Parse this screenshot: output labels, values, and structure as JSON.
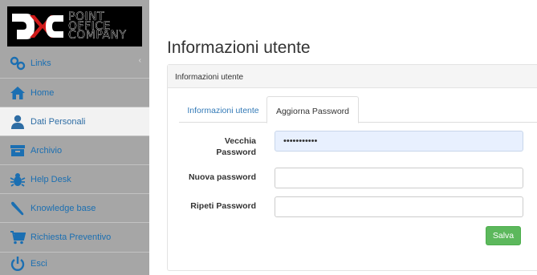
{
  "logo": {
    "line1": "POINT",
    "line2": "OFFICE",
    "line3": "COMPANY"
  },
  "sidebar": {
    "collapse_glyph": "‹",
    "items": [
      {
        "label": "Links",
        "icon": "link-icon"
      },
      {
        "label": "Home",
        "icon": "home-icon"
      },
      {
        "label": "Dati Personali",
        "icon": "user-icon"
      },
      {
        "label": "Archivio",
        "icon": "archive-icon"
      },
      {
        "label": "Help Desk",
        "icon": "bug-icon"
      },
      {
        "label": "Knowledge base",
        "icon": "book-icon"
      },
      {
        "label": "Richiesta Preventivo",
        "icon": "cart-icon"
      },
      {
        "label": "Esci",
        "icon": "power-icon"
      }
    ],
    "active_item": "Dati Personali"
  },
  "page": {
    "title": "Informazioni utente",
    "panel_heading": "Informazioni utente",
    "tabs": [
      {
        "label": "Informazioni utente",
        "active": false
      },
      {
        "label": "Aggiorna Password",
        "active": true
      }
    ],
    "form": {
      "old_password_label_line1": "Vecchia",
      "old_password_label_line2": "Password",
      "old_password_value": "•••••••••••",
      "new_password_label": "Nuova password",
      "new_password_value": "",
      "repeat_password_label": "Ripeti Password",
      "repeat_password_value": "",
      "save_label": "Salva"
    }
  },
  "colors": {
    "sidebar_bg": "#a6a6a6",
    "nav_text": "#1b6fb2",
    "active_bg": "#f2f2f2",
    "save_button": "#5cb85c",
    "autofill_bg": "#e8f0fe"
  }
}
